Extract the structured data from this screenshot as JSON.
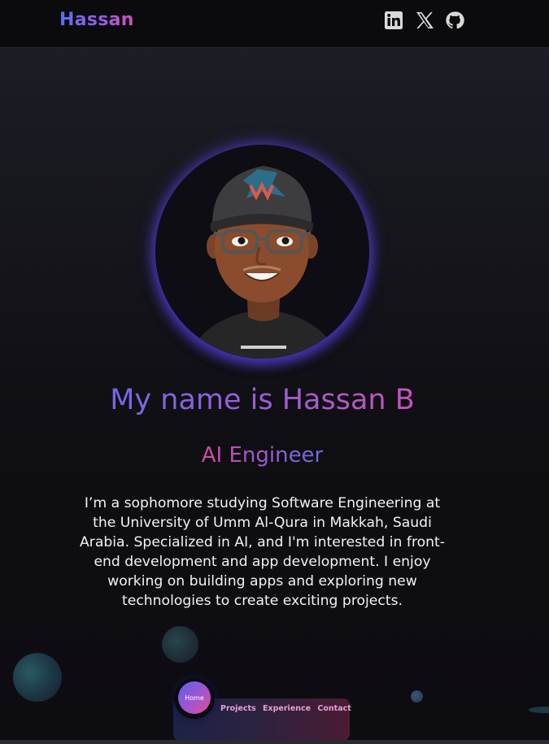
{
  "header": {
    "brand": "Hassan",
    "social": [
      "linkedin-icon",
      "x-icon",
      "github-icon"
    ]
  },
  "hero": {
    "avatar": "avatar-image",
    "headline": "My name is Hassan B",
    "role": "AI Engineer",
    "bio": "I’m a sophomore studying Software Engineering at the University of Umm Al-Qura in Makkah, Saudi Arabia. Specialized in AI, and I'm interested in front-end development and app development. I enjoy working on building apps and exploring new technologies to create exciting projects."
  },
  "dock": {
    "home": "Home",
    "links": [
      "Projects",
      "Experience",
      "Contact"
    ]
  },
  "colors": {
    "accent_blue": "#5b6cf0",
    "accent_purple": "#9a5de0",
    "accent_pink": "#d452b4",
    "background": "#0c0b10"
  }
}
